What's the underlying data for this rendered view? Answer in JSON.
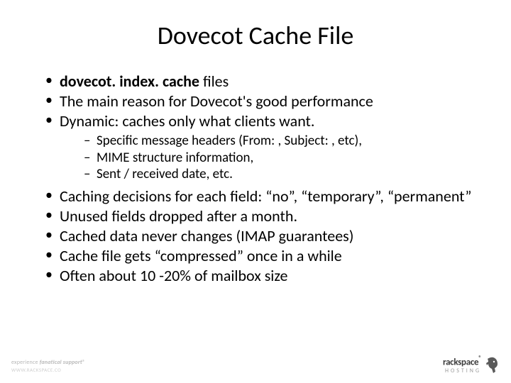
{
  "title": "Dovecot Cache File",
  "bullets_top": [
    {
      "bold": "dovecot. index. cache",
      "rest": " files"
    },
    {
      "text": "The main reason for Dovecot's good performance"
    },
    {
      "text": "Dynamic: caches only what clients want."
    }
  ],
  "sub_bullets": [
    "Specific message headers (From: , Subject: , etc),",
    "MIME structure information,",
    "Sent / received date, etc."
  ],
  "bullets_bottom": [
    "Caching decisions for each field: “no”, “temporary”, “permanent”",
    "Unused fields dropped after a month.",
    "Cached data never changes (IMAP guarantees)",
    "Cache file gets “compressed” once in a while",
    "Often about 10 -20% of mailbox size"
  ],
  "footer_left": {
    "line1_a": "experience ",
    "line1_b": "fanatical support",
    "line1_c": "®",
    "line2": "WWW.RACKSPACE.CO"
  },
  "footer_right": {
    "name": "rackspace",
    "reg": "®",
    "hosting": "HOSTING"
  }
}
